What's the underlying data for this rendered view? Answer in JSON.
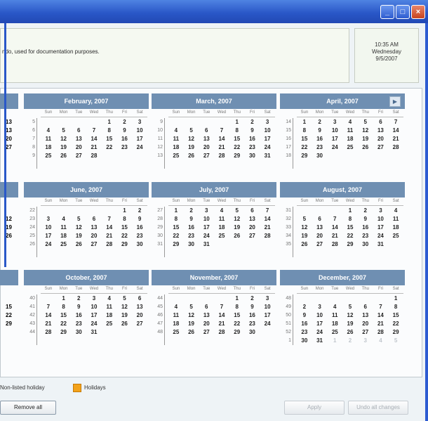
{
  "window": {
    "min": "_",
    "max": "□",
    "close": "×"
  },
  "info": {
    "text": "ndo, used for documentation purposes."
  },
  "clock": {
    "time": "10:35 AM",
    "day": "Wednesday",
    "date": "9/5/2007"
  },
  "dow": [
    "Sun",
    "Mon",
    "Tue",
    "Wed",
    "Thu",
    "Fri",
    "Sat"
  ],
  "months": [
    {
      "title": "February, 2007",
      "weeks": [
        "5",
        "6",
        "7",
        "8",
        "9"
      ],
      "days": [
        "",
        "",
        "",
        "",
        "1",
        "2",
        "3",
        "4",
        "5",
        "6",
        "7",
        "8",
        "9",
        "10",
        "11",
        "12",
        "13",
        "14",
        "15",
        "16",
        "17",
        "18",
        "19",
        "20",
        "21",
        "22",
        "23",
        "24",
        "25",
        "26",
        "27",
        "28",
        "",
        "",
        ""
      ]
    },
    {
      "title": "March, 2007",
      "weeks": [
        "9",
        "10",
        "11",
        "12",
        "13"
      ],
      "days": [
        "",
        "",
        "",
        "",
        "1",
        "2",
        "3",
        "4",
        "5",
        "6",
        "7",
        "8",
        "9",
        "10",
        "11",
        "12",
        "13",
        "14",
        "15",
        "16",
        "17",
        "18",
        "19",
        "20",
        "21",
        "22",
        "23",
        "24",
        "25",
        "26",
        "27",
        "28",
        "29",
        "30",
        "31"
      ]
    },
    {
      "title": "April, 2007",
      "weeks": [
        "14",
        "15",
        "16",
        "17",
        "18"
      ],
      "days": [
        "1",
        "2",
        "3",
        "4",
        "5",
        "6",
        "7",
        "8",
        "9",
        "10",
        "11",
        "12",
        "13",
        "14",
        "15",
        "16",
        "17",
        "18",
        "19",
        "20",
        "21",
        "22",
        "23",
        "24",
        "25",
        "26",
        "27",
        "28",
        "29",
        "30",
        "",
        "",
        "",
        "",
        ""
      ]
    },
    {
      "title": "June, 2007",
      "weeks": [
        "22",
        "23",
        "24",
        "25",
        "26"
      ],
      "days": [
        "",
        "",
        "",
        "",
        "",
        "1",
        "2",
        "3",
        "4",
        "5",
        "6",
        "7",
        "8",
        "9",
        "10",
        "11",
        "12",
        "13",
        "14",
        "15",
        "16",
        "17",
        "18",
        "19",
        "20",
        "21",
        "22",
        "23",
        "24",
        "25",
        "26",
        "27",
        "28",
        "29",
        "30"
      ]
    },
    {
      "title": "July, 2007",
      "weeks": [
        "27",
        "28",
        "29",
        "30",
        "31"
      ],
      "days": [
        "1",
        "2",
        "3",
        "4",
        "5",
        "6",
        "7",
        "8",
        "9",
        "10",
        "11",
        "12",
        "13",
        "14",
        "15",
        "16",
        "17",
        "18",
        "19",
        "20",
        "21",
        "22",
        "23",
        "24",
        "25",
        "26",
        "27",
        "28",
        "29",
        "30",
        "31",
        "",
        "",
        "",
        ""
      ]
    },
    {
      "title": "August, 2007",
      "weeks": [
        "31",
        "32",
        "33",
        "34",
        "35"
      ],
      "days": [
        "",
        "",
        "",
        "1",
        "2",
        "3",
        "4",
        "5",
        "6",
        "7",
        "8",
        "9",
        "10",
        "11",
        "12",
        "13",
        "14",
        "15",
        "16",
        "17",
        "18",
        "19",
        "20",
        "21",
        "22",
        "23",
        "24",
        "25",
        "26",
        "27",
        "28",
        "29",
        "30",
        "31",
        ""
      ]
    },
    {
      "title": "October, 2007",
      "weeks": [
        "40",
        "41",
        "42",
        "43",
        "44"
      ],
      "days": [
        "",
        "1",
        "2",
        "3",
        "4",
        "5",
        "6",
        "7",
        "8",
        "9",
        "10",
        "11",
        "12",
        "13",
        "14",
        "15",
        "16",
        "17",
        "18",
        "19",
        "20",
        "21",
        "22",
        "23",
        "24",
        "25",
        "26",
        "27",
        "28",
        "29",
        "30",
        "31",
        "",
        "",
        ""
      ]
    },
    {
      "title": "November, 2007",
      "weeks": [
        "44",
        "45",
        "46",
        "47",
        "48"
      ],
      "days": [
        "",
        "",
        "",
        "",
        "1",
        "2",
        "3",
        "4",
        "5",
        "6",
        "7",
        "8",
        "9",
        "10",
        "11",
        "12",
        "13",
        "14",
        "15",
        "16",
        "17",
        "18",
        "19",
        "20",
        "21",
        "22",
        "23",
        "24",
        "25",
        "26",
        "27",
        "28",
        "29",
        "30",
        ""
      ]
    },
    {
      "title": "December, 2007",
      "weeks": [
        "48",
        "49",
        "50",
        "51",
        "52",
        "1"
      ],
      "days": [
        "",
        "",
        "",
        "",
        "",
        "",
        "1",
        "2",
        "3",
        "4",
        "5",
        "6",
        "7",
        "8",
        "9",
        "10",
        "11",
        "12",
        "13",
        "14",
        "15",
        "16",
        "17",
        "18",
        "19",
        "20",
        "21",
        "22",
        "23",
        "24",
        "25",
        "26",
        "27",
        "28",
        "29",
        "30",
        "31",
        "1",
        "2",
        "3",
        "4",
        "5"
      ]
    }
  ],
  "partial": {
    "row1": [
      "13",
      "20",
      "27"
    ],
    "row2": [
      "12",
      "19",
      "26"
    ],
    "row3": [
      "15",
      "22",
      "29"
    ]
  },
  "legend": {
    "before": "Non-listed holiday",
    "holidays": "Holidays"
  },
  "buttons": {
    "remove": "Remove all",
    "apply": "Apply",
    "undo": "Undo all changes"
  }
}
